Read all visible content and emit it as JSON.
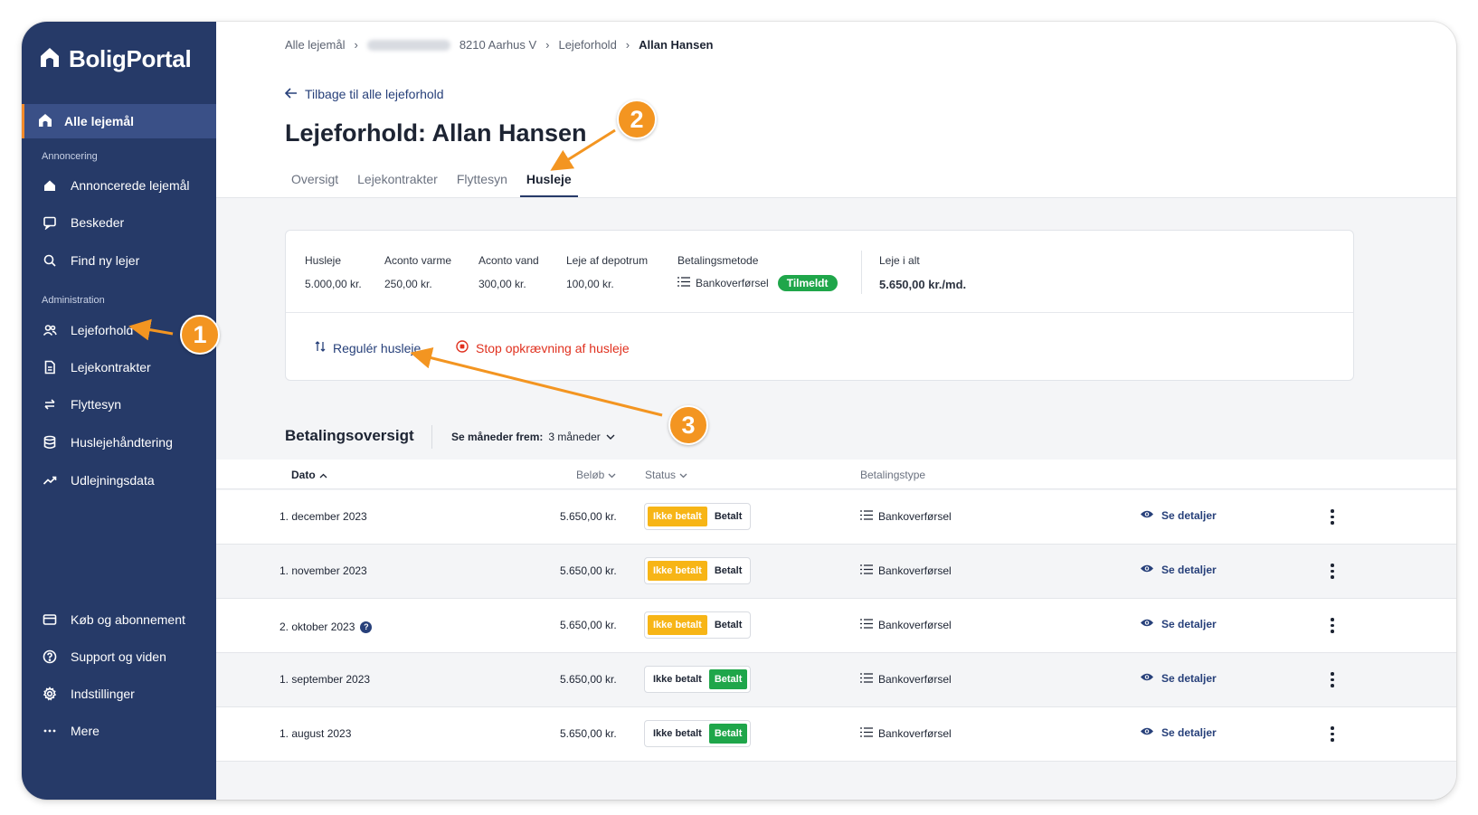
{
  "app": {
    "name": "BoligPortal"
  },
  "sidebar": {
    "active_item": "Alle lejemål",
    "sections": [
      {
        "label": "Annoncering"
      },
      {
        "label": "Administration"
      }
    ],
    "items": [
      {
        "label": "Annoncerede lejemål",
        "icon": "house-icon"
      },
      {
        "label": "Beskeder",
        "icon": "chat-icon"
      },
      {
        "label": "Find ny lejer",
        "icon": "search-icon"
      },
      {
        "label": "Lejeforhold",
        "icon": "people-icon"
      },
      {
        "label": "Lejekontrakter",
        "icon": "document-icon"
      },
      {
        "label": "Flyttesyn",
        "icon": "swap-icon"
      },
      {
        "label": "Huslejehåndtering",
        "icon": "database-icon"
      },
      {
        "label": "Udlejningsdata",
        "icon": "trend-icon"
      }
    ],
    "bottom_items": [
      {
        "label": "Køb og abonnement",
        "icon": "card-icon"
      },
      {
        "label": "Support og viden",
        "icon": "help-icon"
      },
      {
        "label": "Indstillinger",
        "icon": "gear-icon"
      },
      {
        "label": "Mere",
        "icon": "dots-icon"
      }
    ]
  },
  "breadcrumb": {
    "items": [
      "Alle lejemål",
      "8210 Aarhus V",
      "Lejeforhold",
      "Allan Hansen"
    ]
  },
  "header": {
    "back_label": "Tilbage til alle lejeforhold",
    "title_prefix": "Lejeforhold:",
    "title_name": "Allan Hansen",
    "tabs": [
      "Oversigt",
      "Lejekontrakter",
      "Flyttesyn",
      "Husleje"
    ],
    "active_tab": "Husleje"
  },
  "rent_card": {
    "fields": [
      {
        "label": "Husleje",
        "value": "5.000,00 kr."
      },
      {
        "label": "Aconto varme",
        "value": "250,00 kr."
      },
      {
        "label": "Aconto vand",
        "value": "300,00 kr."
      },
      {
        "label": "Leje af depotrum",
        "value": "100,00 kr."
      }
    ],
    "payment_method": {
      "label": "Betalingsmetode",
      "value": "Bankoverførsel",
      "badge": "Tilmeldt"
    },
    "total": {
      "label": "Leje i alt",
      "value": "5.650,00 kr./md."
    },
    "actions": {
      "adjust": "Regulér husleje",
      "stop": "Stop opkrævning af husleje"
    }
  },
  "payments": {
    "title": "Betalingsoversigt",
    "months_label": "Se måneder frem:",
    "months_value": "3 måneder",
    "columns": [
      "Dato",
      "Beløb",
      "Status",
      "Betalingstype"
    ],
    "status_labels": {
      "unpaid": "Ikke betalt",
      "paid": "Betalt"
    },
    "details_label": "Se detaljer",
    "rows": [
      {
        "date": "1. december 2023",
        "amount": "5.650,00 kr.",
        "status": "unpaid",
        "type": "Bankoverførsel",
        "info": false
      },
      {
        "date": "1. november 2023",
        "amount": "5.650,00 kr.",
        "status": "unpaid",
        "type": "Bankoverførsel",
        "info": false
      },
      {
        "date": "2. oktober 2023",
        "amount": "5.650,00 kr.",
        "status": "unpaid",
        "type": "Bankoverførsel",
        "info": true
      },
      {
        "date": "1. september 2023",
        "amount": "5.650,00 kr.",
        "status": "paid",
        "type": "Bankoverførsel",
        "info": false
      },
      {
        "date": "1. august 2023",
        "amount": "5.650,00 kr.",
        "status": "paid",
        "type": "Bankoverførsel",
        "info": false
      }
    ]
  },
  "annotations": {
    "steps": [
      "1",
      "2",
      "3"
    ]
  },
  "colors": {
    "sidebar": "#263a68",
    "sidebar_active": "#3a5087",
    "accent": "#f39521",
    "link": "#27407a",
    "danger": "#e0311f",
    "success": "#1fa64a",
    "warning": "#f7b516"
  }
}
